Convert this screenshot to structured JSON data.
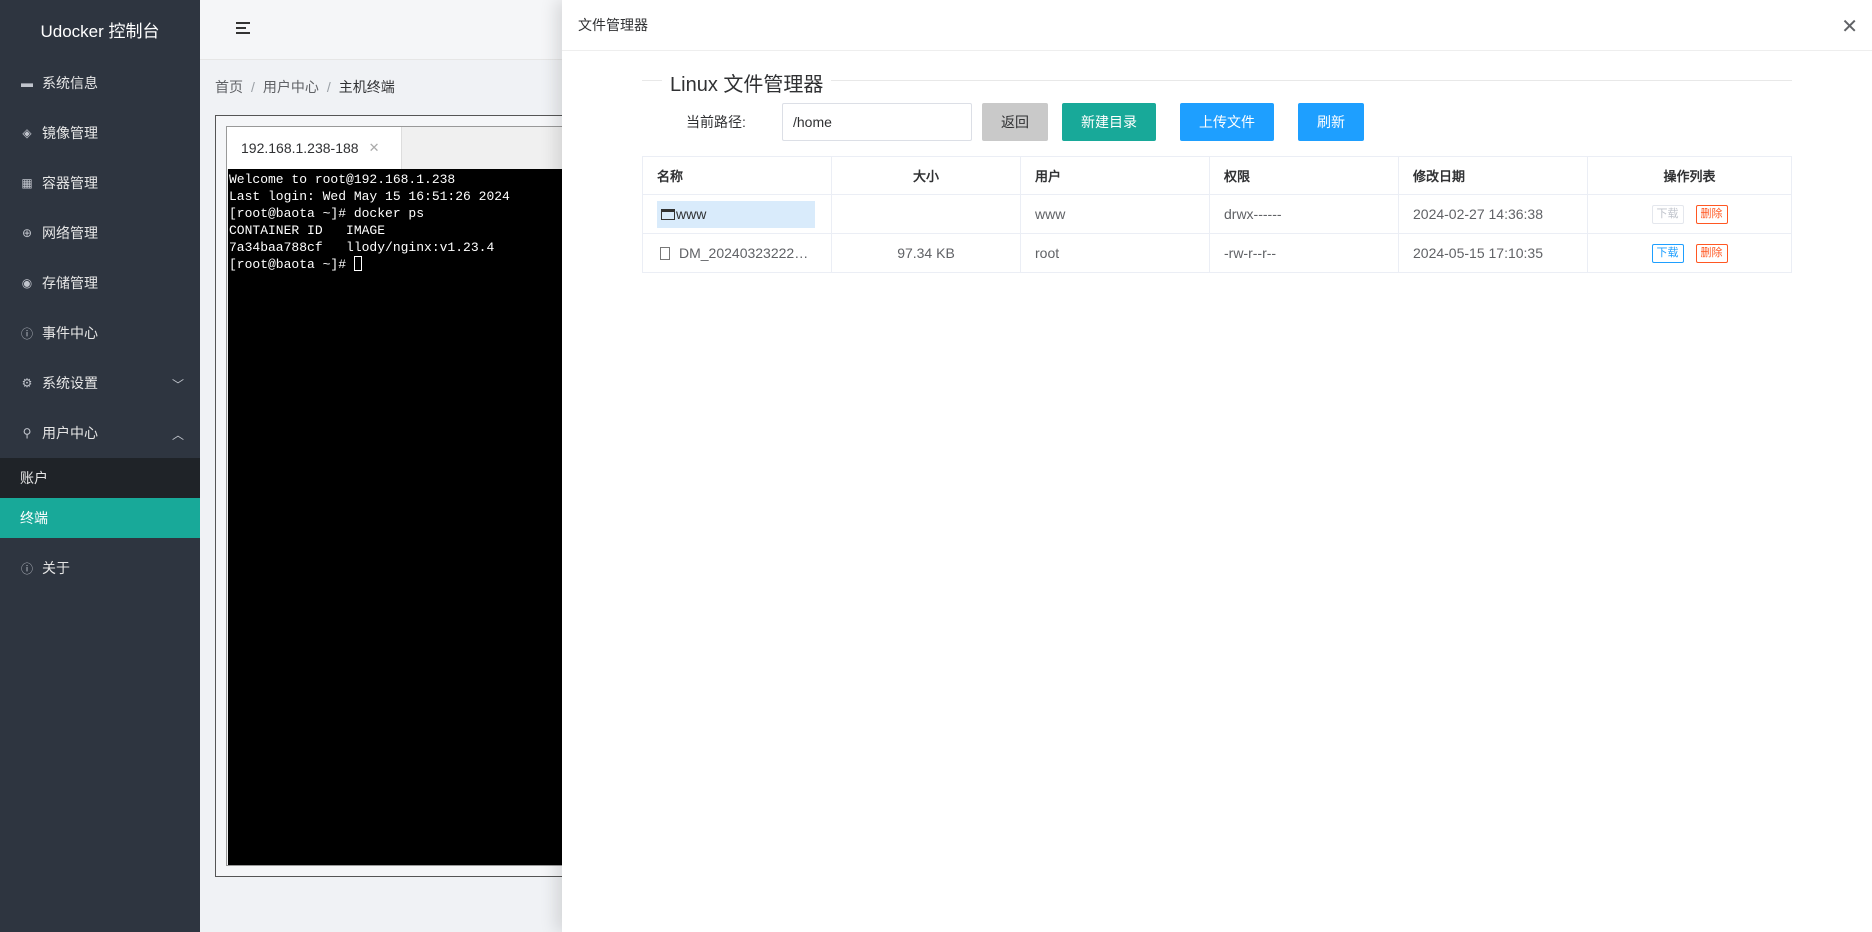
{
  "sidebar": {
    "title": "Udocker 控制台",
    "items": [
      {
        "label": "系统信息",
        "icon": "monitor-icon"
      },
      {
        "label": "镜像管理",
        "icon": "layers-icon"
      },
      {
        "label": "容器管理",
        "icon": "grid-icon"
      },
      {
        "label": "网络管理",
        "icon": "globe-icon"
      },
      {
        "label": "存储管理",
        "icon": "storage-icon"
      },
      {
        "label": "事件中心",
        "icon": "info-icon"
      },
      {
        "label": "系统设置",
        "icon": "gear-icon"
      },
      {
        "label": "用户中心",
        "icon": "user-icon"
      }
    ],
    "sub_items": [
      {
        "label": "账户"
      },
      {
        "label": "终端",
        "active": true
      }
    ],
    "about": "关于"
  },
  "breadcrumb": {
    "home": "首页",
    "user": "用户中心",
    "current": "主机终端"
  },
  "terminal": {
    "tab": "192.168.1.238-188",
    "lines": [
      "Welcome to root@192.168.1.238",
      "Last login: Wed May 15 16:51:26 2024",
      "[root@baota ~]# docker ps",
      "CONTAINER ID   IMAGE",
      "7a34baa788cf   llody/nginx:v1.23.4",
      "[root@baota ~]# "
    ]
  },
  "drawer": {
    "title": "文件管理器",
    "fm_title": "Linux 文件管理器",
    "path_label": "当前路径:",
    "path_value": "/home",
    "buttons": {
      "back": "返回",
      "mkdir": "新建目录",
      "upload": "上传文件",
      "refresh": "刷新"
    },
    "columns": [
      "名称",
      "大小",
      "用户",
      "权限",
      "修改日期",
      "操作列表"
    ],
    "rows": [
      {
        "name": "www",
        "type": "dir",
        "size": "",
        "user": "www",
        "perm": "drwx------",
        "date": "2024-02-27 14:36:38",
        "download": "下载",
        "delete": "删除"
      },
      {
        "name": "DM_20240323222…",
        "type": "file",
        "size": "97.34 KB",
        "user": "root",
        "perm": "-rw-r--r--",
        "date": "2024-05-15 17:10:35",
        "download": "下载",
        "delete": "删除"
      }
    ]
  }
}
